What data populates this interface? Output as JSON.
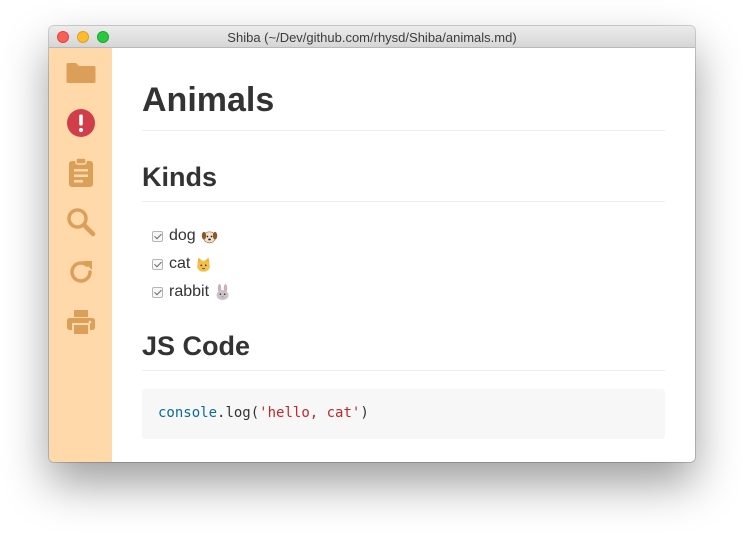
{
  "window": {
    "title": "Shiba (~/Dev/github.com/rhysd/Shiba/animals.md)"
  },
  "sidebar": {
    "buttons": [
      {
        "name": "folder-icon",
        "color": "#dc9f5a"
      },
      {
        "name": "alert-icon",
        "color": "#d13e4a"
      },
      {
        "name": "clipboard-icon",
        "color": "#dc9f5a"
      },
      {
        "name": "search-icon",
        "color": "#dc9f5a"
      },
      {
        "name": "reload-icon",
        "color": "#dc9f5a"
      },
      {
        "name": "print-icon",
        "color": "#dc9f5a"
      }
    ],
    "background": "#ffd9aa"
  },
  "document": {
    "title": "Animals",
    "sections": [
      {
        "heading": "Kinds",
        "tasks": [
          {
            "label": "dog",
            "checked": true,
            "emoji": "dog-face"
          },
          {
            "label": "cat",
            "checked": true,
            "emoji": "cat-face"
          },
          {
            "label": "rabbit",
            "checked": true,
            "emoji": "rabbit-face"
          }
        ]
      },
      {
        "heading": "JS Code",
        "code": {
          "object": "console",
          "dot": ".",
          "method": "log(",
          "string": "'hello, cat'",
          "close": ")"
        }
      }
    ]
  }
}
